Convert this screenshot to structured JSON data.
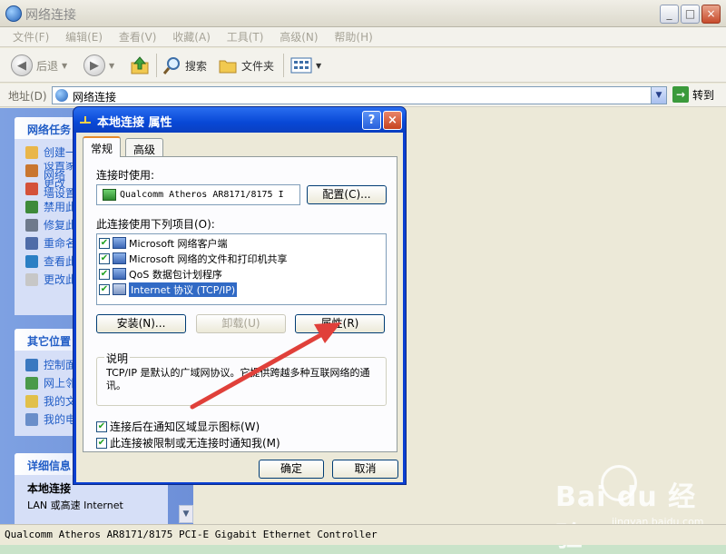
{
  "window": {
    "title": "网络连接",
    "controls": [
      "_",
      "□",
      "×"
    ]
  },
  "menu": [
    "文件(F)",
    "编辑(E)",
    "查看(V)",
    "收藏(A)",
    "工具(T)",
    "高级(N)",
    "帮助(H)"
  ],
  "toolbar": {
    "back": "后退",
    "search": "搜索",
    "folders": "文件夹"
  },
  "address": {
    "label": "地址(D)",
    "value": "网络连接",
    "go": "转到"
  },
  "left_panel": {
    "tasks": {
      "title": "网络任务",
      "items": [
        {
          "label": "创建一",
          "icon": "new-connection-icon",
          "color": "#e9b64a"
        },
        {
          "label": "设置家\n网络",
          "icon": "home-network-icon",
          "color": "#c9762f"
        },
        {
          "label": "更改\n墙设置",
          "icon": "firewall-icon",
          "color": "#d4513a"
        },
        {
          "label": "禁用此",
          "icon": "disable-icon",
          "color": "#3d8a3a"
        },
        {
          "label": "修复此",
          "icon": "repair-icon",
          "color": "#6e7a8c"
        },
        {
          "label": "重命名",
          "icon": "rename-icon",
          "color": "#4f6ca8"
        },
        {
          "label": "查看此",
          "icon": "status-icon",
          "color": "#2b7fc4"
        },
        {
          "label": "更改此",
          "icon": "settings-icon",
          "color": "#c7c7c7"
        }
      ]
    },
    "other_places": {
      "title": "其它位置",
      "items": [
        {
          "label": "控制面",
          "icon": "control-panel-icon",
          "color": "#3a78c0"
        },
        {
          "label": "网上邻",
          "icon": "network-places-icon",
          "color": "#4a9a4a"
        },
        {
          "label": "我的文",
          "icon": "documents-icon",
          "color": "#e1c04a"
        },
        {
          "label": "我的电",
          "icon": "computer-icon",
          "color": "#6a8ec9"
        }
      ]
    },
    "details": {
      "title": "详细信息",
      "name": "本地连接",
      "desc": "LAN 或高速 Internet"
    }
  },
  "status_bar": "Qualcomm Atheros AR8171/8175 PCI-E Gigabit Ethernet Controller",
  "watermark": {
    "brand": "Bai du 经验",
    "url": "jingyan.baidu.com"
  },
  "dialog": {
    "title": "本地连接 属性",
    "help": "?",
    "close": "×",
    "tabs": [
      "常规",
      "高级"
    ],
    "connect_using_label": "连接时使用:",
    "adapter": "Qualcomm Atheros AR8171/8175 I",
    "configure_button": "配置(C)...",
    "items_label": "此连接使用下列项目(O):",
    "items": [
      {
        "label": "Microsoft 网络客户端",
        "checked": true,
        "selected": false
      },
      {
        "label": "Microsoft 网络的文件和打印机共享",
        "checked": true,
        "selected": false
      },
      {
        "label": "QoS 数据包计划程序",
        "checked": true,
        "selected": false
      },
      {
        "label": "Internet 协议 (TCP/IP)",
        "checked": true,
        "selected": true
      }
    ],
    "install_button": "安装(N)...",
    "uninstall_button": "卸载(U)",
    "properties_button": "属性(R)",
    "description_title": "说明",
    "description": "TCP/IP 是默认的广域网协议。它提供跨越多种互联网络的通讯。",
    "checkbox_show_icon": "连接后在通知区域显示图标(W)",
    "checkbox_notify": "此连接被限制或无连接时通知我(M)",
    "ok_button": "确定",
    "cancel_button": "取消"
  }
}
